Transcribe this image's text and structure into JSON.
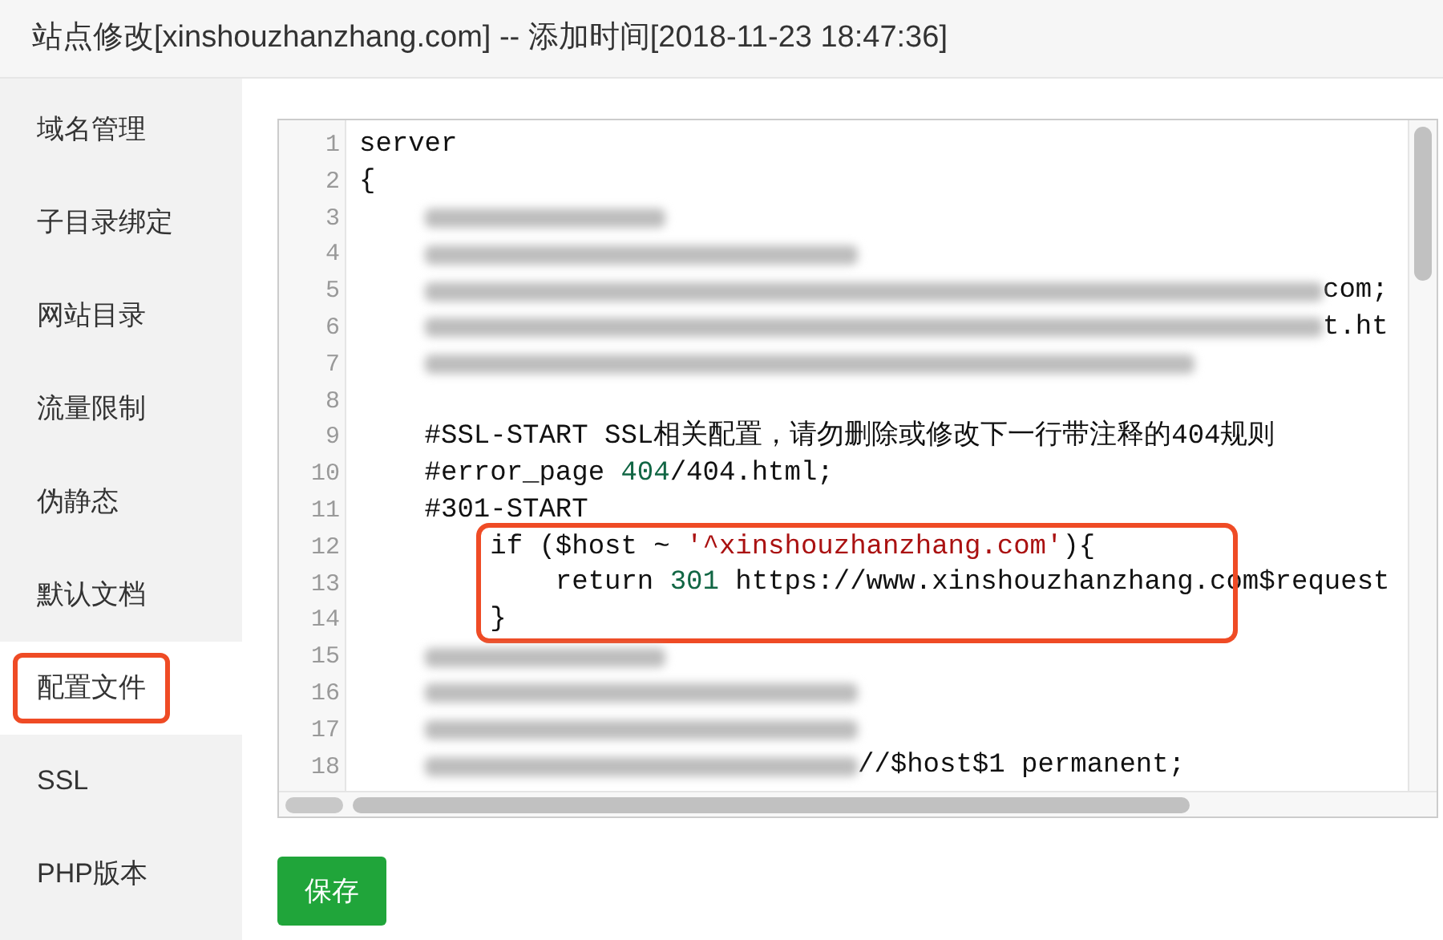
{
  "window": {
    "title": "站点修改[xinshouzhanzhang.com] -- 添加时间[2018-11-23 18:47:36]"
  },
  "sidebar": {
    "items": [
      {
        "label": "域名管理",
        "selected": false,
        "highlighted": false
      },
      {
        "label": "子目录绑定",
        "selected": false,
        "highlighted": false
      },
      {
        "label": "网站目录",
        "selected": false,
        "highlighted": false
      },
      {
        "label": "流量限制",
        "selected": false,
        "highlighted": false
      },
      {
        "label": "伪静态",
        "selected": false,
        "highlighted": false
      },
      {
        "label": "默认文档",
        "selected": false,
        "highlighted": false
      },
      {
        "label": "配置文件",
        "selected": true,
        "highlighted": true
      },
      {
        "label": "SSL",
        "selected": false,
        "highlighted": false
      },
      {
        "label": "PHP版本",
        "selected": false,
        "highlighted": false
      }
    ]
  },
  "editor": {
    "lines": [
      {
        "number": "1",
        "highlighted": false,
        "tokens": [
          {
            "kind": "plain",
            "text": "server"
          }
        ]
      },
      {
        "number": "2",
        "highlighted": false,
        "tokens": [
          {
            "kind": "plain",
            "text": "{"
          }
        ]
      },
      {
        "number": "3",
        "highlighted": false,
        "tokens": [
          {
            "kind": "redacted_short"
          }
        ]
      },
      {
        "number": "4",
        "highlighted": false,
        "tokens": [
          {
            "kind": "redacted_medium"
          }
        ]
      },
      {
        "number": "5",
        "highlighted": false,
        "tokens": [
          {
            "kind": "redacted_long"
          },
          {
            "kind": "plain",
            "text": "com;"
          }
        ]
      },
      {
        "number": "6",
        "highlighted": false,
        "tokens": [
          {
            "kind": "redacted_long"
          },
          {
            "kind": "plain",
            "text": "t.ht"
          }
        ]
      },
      {
        "number": "7",
        "highlighted": false,
        "tokens": [
          {
            "kind": "redacted_wide"
          }
        ]
      },
      {
        "number": "8",
        "highlighted": false
      },
      {
        "number": "9",
        "highlighted": false,
        "tokens": [
          {
            "kind": "plain",
            "text": "    #SSL-START SSL相关配置，请勿删除或修改下一行带注释的404规则"
          }
        ]
      },
      {
        "number": "10",
        "highlighted": false,
        "tokens": [
          {
            "kind": "plain",
            "text": "    #error_page "
          },
          {
            "kind": "number",
            "text": "404"
          },
          {
            "kind": "plain",
            "text": "/404.html;"
          }
        ]
      },
      {
        "number": "11",
        "highlighted": false,
        "tokens": [
          {
            "kind": "plain",
            "text": "    #301-START"
          }
        ]
      },
      {
        "number": "12",
        "highlighted": true,
        "tokens": [
          {
            "kind": "plain",
            "text": "        if ($host ~ "
          },
          {
            "kind": "string",
            "text": "'^xinshouzhanzhang.com'"
          },
          {
            "kind": "plain",
            "text": "){"
          }
        ]
      },
      {
        "number": "13",
        "highlighted": true,
        "tokens": [
          {
            "kind": "plain",
            "text": "            return "
          },
          {
            "kind": "number",
            "text": "301"
          },
          {
            "kind": "plain",
            "text": " https://www.xinshouzhanzhang.com$request"
          }
        ]
      },
      {
        "number": "14",
        "highlighted": true,
        "tokens": [
          {
            "kind": "plain",
            "text": "        }"
          }
        ]
      },
      {
        "number": "15",
        "highlighted": false,
        "tokens": [
          {
            "kind": "redacted_short"
          }
        ]
      },
      {
        "number": "16",
        "highlighted": false,
        "tokens": [
          {
            "kind": "redacted_medium"
          }
        ]
      },
      {
        "number": "17",
        "highlighted": false,
        "tokens": [
          {
            "kind": "redacted_medium"
          }
        ]
      },
      {
        "number": "18",
        "highlighted": false,
        "tokens": [
          {
            "kind": "redacted_medium"
          },
          {
            "kind": "plain",
            "text": "//$host$1 permanent;"
          }
        ]
      }
    ]
  },
  "buttons": [
    {
      "label": "保存"
    }
  ]
}
